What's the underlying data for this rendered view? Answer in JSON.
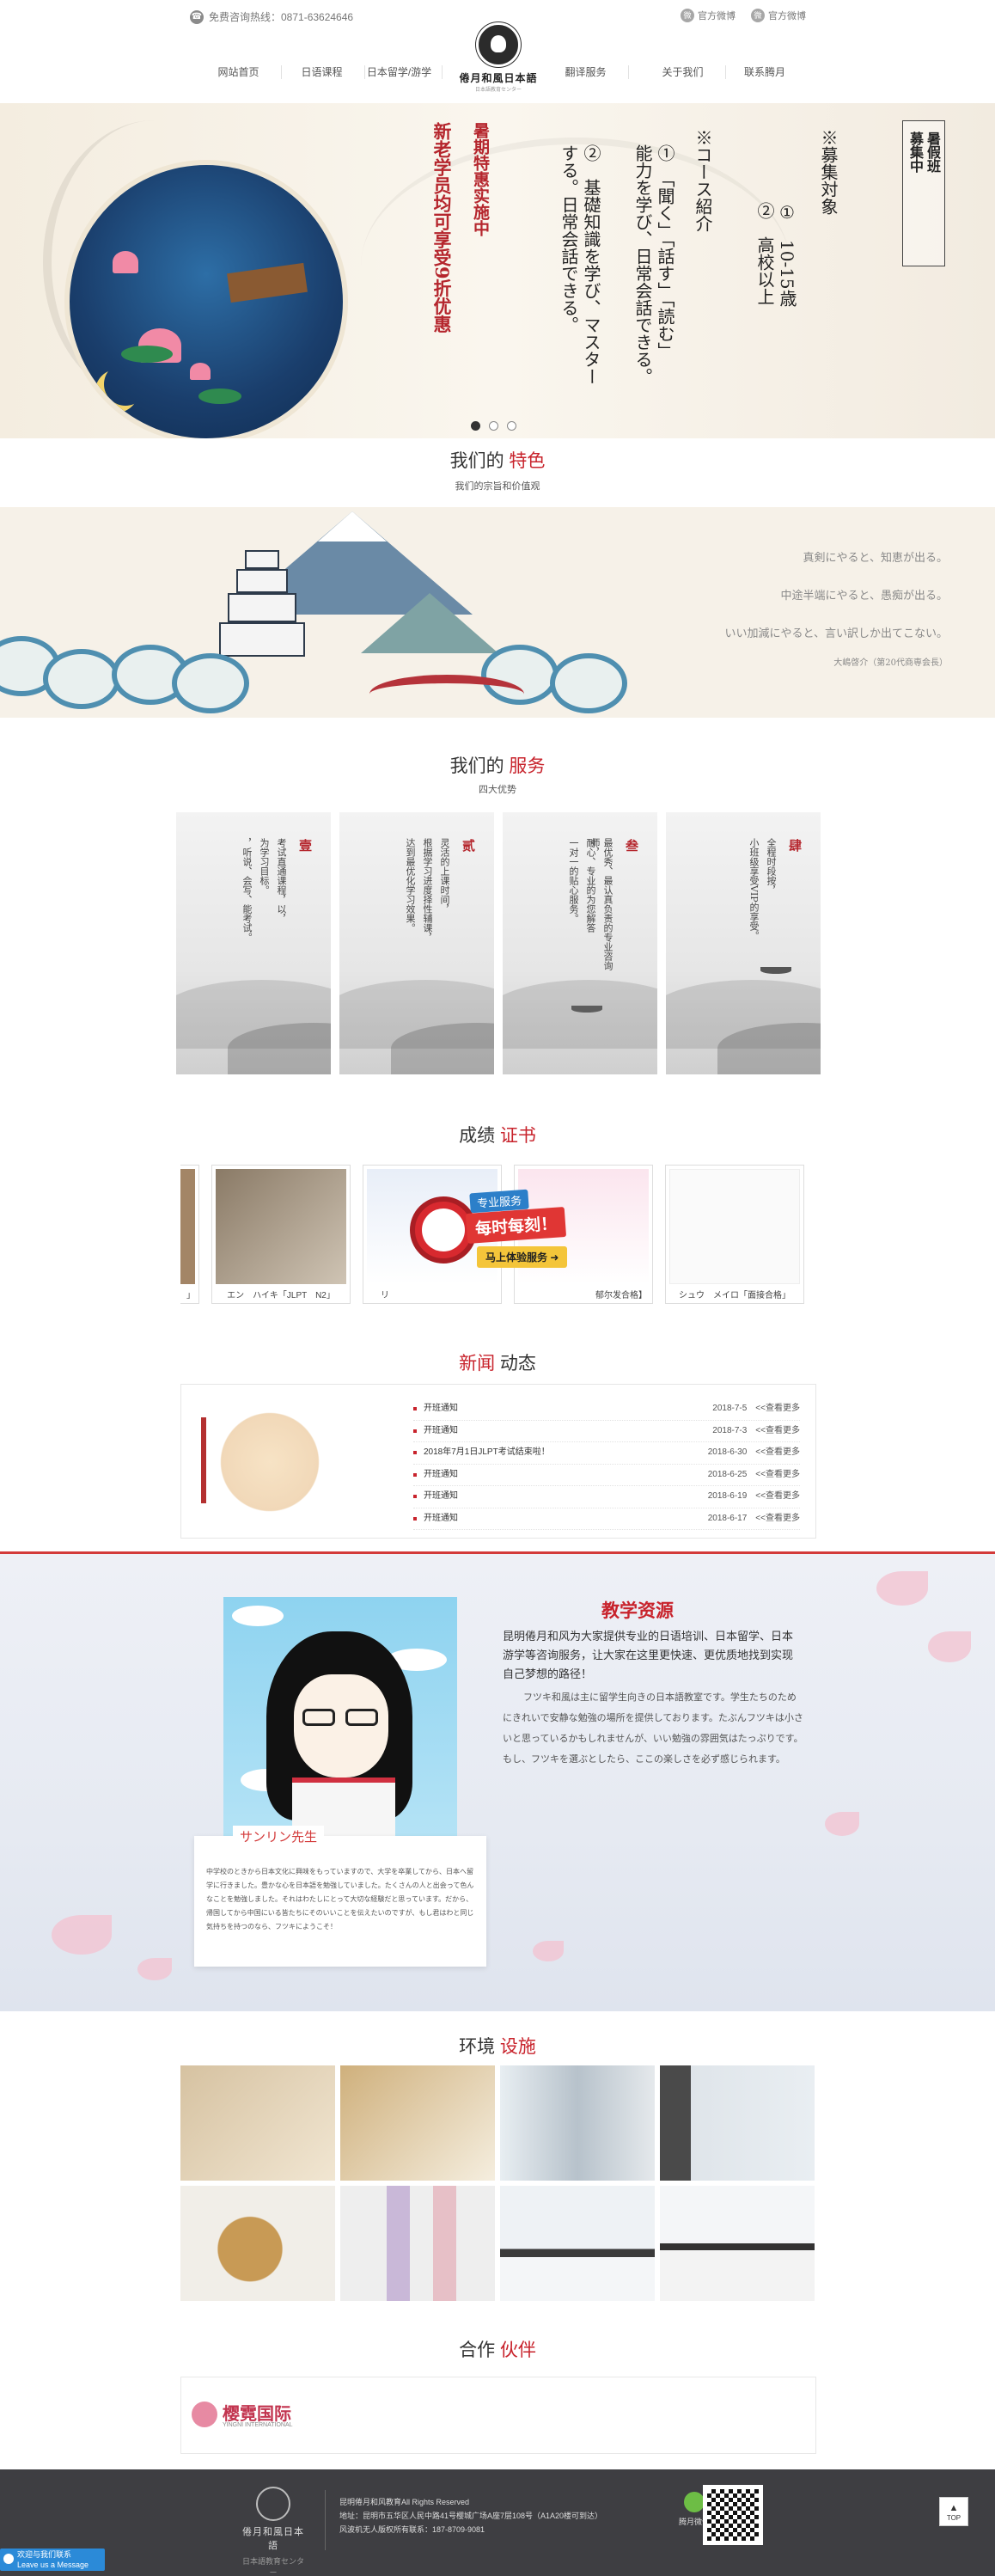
{
  "topbar": {
    "hotline": "免费咨询热线：0871-63624646",
    "social": [
      "官方微博",
      "官方微博"
    ]
  },
  "nav": {
    "items": [
      "网站首页",
      "日语课程",
      "日本留学/游学",
      "",
      "翻译服务",
      "关于我们",
      "联系腾月"
    ]
  },
  "logo": {
    "name": "倦月和風日本語",
    "sub": "日本語教育センター"
  },
  "banner": {
    "col1": [
      "暑假班",
      "募集中"
    ],
    "col2": "※募集対象",
    "col3": "①　10-15歳",
    "col4": "②　高校以上",
    "col5": "※コース紹介",
    "col6": "①　「聞く」「話す」「読む」",
    "col7": "能力を学び、日常会話できる。",
    "col8": "②　基礎知識を学び、マスター",
    "col9": "する。日常会話できる。",
    "red1": "暑期特惠实施中",
    "red2": "新老学员均可享受9折优惠"
  },
  "feature": {
    "title_a": "我们的",
    "title_b": "特色",
    "sub": "我们的宗旨和价值观",
    "quote": [
      "真剣にやると、知恵が出る。",
      "中途半端にやると、愚痴が出る。",
      "いい加減にやると、言い訳しか出てこない。",
      "大嶋啓介（第20代商専会長）"
    ]
  },
  "service": {
    "title_a": "我们的",
    "title_b": "服务",
    "sub": "四大优势",
    "items": [
      {
        "num": "壹",
        "text": [
          "考试直通课程，以，",
          "为学习目标。",
          "，听说、会写、能考试。"
        ]
      },
      {
        "num": "贰",
        "text": [
          "灵活的上课时间，",
          "根据学习进度择性辅课，",
          "达到最优化学习效果。"
        ]
      },
      {
        "num": "叁",
        "text": [
          "最优秀、最认真负责的专业咨询师，",
          "耐心、专业的为您解答",
          "一对一的贴心服务。"
        ]
      },
      {
        "num": "肆",
        "text": [
          "全程时段按，",
          "小班级享受VIP的享受。"
        ]
      }
    ]
  },
  "certs": {
    "title_a": "成绩",
    "title_b": "证书",
    "items": [
      "」",
      "エン　ハイキ「JLPT　N2」",
      "リ　",
      "",
      "郁尔发合格】",
      "シュウ　メイロ「面接合格」"
    ],
    "promo": {
      "badge": "专业服务",
      "main": "每时每刻！",
      "cta": "马上体验服务 ➜"
    }
  },
  "news": {
    "title_a": "新闻",
    "title_b": "动态",
    "rows": [
      {
        "t": "开班通知",
        "d": "2018-7-5　<<查看更多"
      },
      {
        "t": "开班通知",
        "d": "2018-7-3　<<查看更多"
      },
      {
        "t": "2018年7月1日JLPT考试结束啦！",
        "d": "2018-6-30　<<查看更多"
      },
      {
        "t": "开班通知",
        "d": "2018-6-25　<<查看更多"
      },
      {
        "t": "开班通知",
        "d": "2018-6-19　<<查看更多"
      },
      {
        "t": "开班通知",
        "d": "2018-6-17　<<查看更多"
      }
    ]
  },
  "teach": {
    "title": "教学资源",
    "teacher": "サンリン先生",
    "p1": "昆明倦月和风为大家提供专业的日语培训、日本留学、日本游学等咨询服务，让大家在这里更快速、更优质地找到实现自己梦想的路径！",
    "p2": "フツキ和風は主に留学生向きの日本語教室です。学生たちのためにきれいで安静な勉強の場所を提供しております。たぶんフツキは小さいと思っているかもしれませんが、いい勉強の雰囲気はたっぷりです。もし、フツキを選ぶとしたら、ここの楽しさを必ず感じられます。",
    "card": "中学校のときから日本文化に興味をもっていますので、大学を卒業してから、日本へ留学に行きました。豊かな心を日本語を勉強していました。たくさんの人と出会って色んなことを勉強しました。それはわたしにとって大切な経験だと思っています。だから、帰国してから中国にいる皆たちにそのいいことを伝えたいのですが、もし君はわと同じ気持ちを持つのなら、フツキにようこそ！"
  },
  "env": {
    "title_a": "环境",
    "title_b": "设施"
  },
  "partner": {
    "title_a": "合作",
    "title_b": "伙伴",
    "name": "樱霓国际",
    "sub": "YINGNI INTERNATIONAL"
  },
  "footer": {
    "name": "倦月和風日本語",
    "sub": "日本語教育センター",
    "info": [
      "昆明倦月和风教育All Rights Reserved",
      "地址：昆明市五华区人民中路41号樱城广场A座7层108号（A1A20楼可到达）",
      "风波机无人版权所有联系：187-8709-9081"
    ],
    "wx": "腾月微信",
    "totop": "TOP"
  },
  "qq": {
    "l1": "欢迎与我们联系",
    "l2": "Leave us a Message"
  }
}
